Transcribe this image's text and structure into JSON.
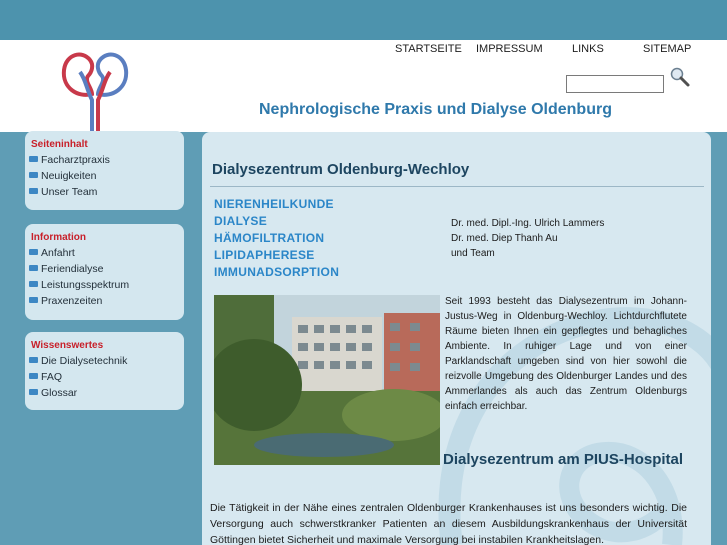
{
  "nav": {
    "startseite": "STARTSEITE",
    "impressum": "IMPRESSUM",
    "links": "LINKS",
    "sitemap": "SITEMAP"
  },
  "search": {
    "value": ""
  },
  "site_title": "Nephrologische Praxis und Dialyse Oldenburg",
  "sidebar": {
    "sections": [
      {
        "title": "Seiteninhalt",
        "items": [
          "Facharztpraxis",
          "Neuigkeiten",
          "Unser Team"
        ]
      },
      {
        "title": "Information",
        "items": [
          "Anfahrt",
          "Feriendialyse",
          "Leistungsspektrum",
          "Praxenzeiten"
        ]
      },
      {
        "title": "Wissenswertes",
        "items": [
          "Die Dialysetechnik",
          "FAQ",
          "Glossar"
        ]
      }
    ]
  },
  "main": {
    "heading": "Dialysezentrum Oldenburg-Wechloy",
    "specialties": [
      "NIERENHEILKUNDE",
      "DIALYSE",
      "HÄMOFILTRATION",
      "LIPIDAPHERESE",
      "IMMUNADSORPTION"
    ],
    "doctors": [
      "Dr. med. Dipl.-Ing. Ulrich Lammers",
      "Dr. med. Diep Thanh Au",
      "und Team"
    ],
    "paragraph1": "Seit 1993 besteht das Dialysezentrum im Johann-Justus-Weg in Oldenburg-Wechloy. Lichtdurchflutete Räume bieten Ihnen ein gepflegtes und behagliches Ambiente. In ruhiger Lage und von einer Parklandschaft umgeben sind von hier sowohl die reizvolle Umgebung des Oldenburger Landes und des Ammerlandes als auch das Zentrum Oldenburgs einfach erreichbar.",
    "heading2": "Dialysezentrum am PIUS-Hospital",
    "paragraph2": "Die Tätigkeit in der Nähe eines zentralen Oldenburger Krankenhauses ist uns besonders wichtig. Die Versorgung auch schwerstkranker Patienten an diesem Ausbildungskrankenhaus der Universität Göttingen bietet Sicherheit und maximale Versorgung bei instabilen Krankheitslagen."
  },
  "colors": {
    "top_band": "#4d93ad",
    "background": "#5f9db5",
    "panel": "#d7e8f0",
    "sidebox": "#d4e7ef",
    "title_blue": "#2f79ab",
    "heading_dark": "#1d4560",
    "specialty_blue": "#2b86c8",
    "section_red": "#c8202a",
    "logo_red": "#c8394a",
    "logo_blue": "#5a7ec0"
  }
}
